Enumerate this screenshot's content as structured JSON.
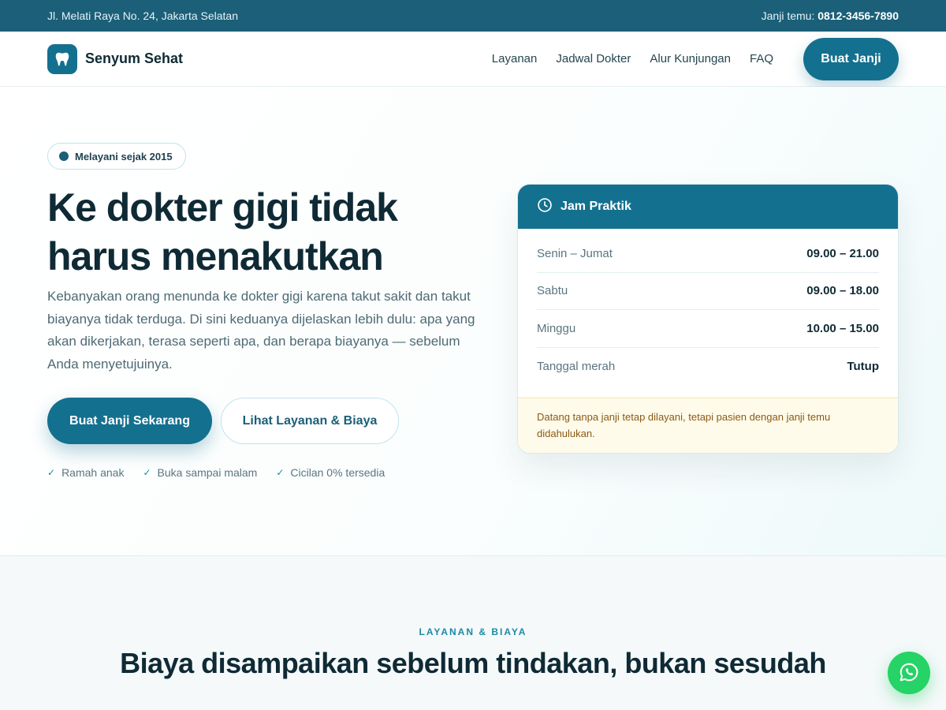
{
  "topbar": {
    "address": "Jl. Melati Raya No. 24, Jakarta Selatan",
    "phone_label": "Janji temu:",
    "phone_number": "0812-3456-7890"
  },
  "nav": {
    "brand": "Senyum Sehat",
    "links": [
      "Layanan",
      "Jadwal Dokter",
      "Alur Kunjungan",
      "FAQ"
    ],
    "cta": "Buat Janji"
  },
  "hero": {
    "badge": "Melayani sejak 2015",
    "title": "Ke dokter gigi tidak harus menakutkan",
    "description": "Kebanyakan orang menunda ke dokter gigi karena takut sakit dan takut biayanya tidak terduga. Di sini keduanya dijelaskan lebih dulu: apa yang akan dikerjakan, terasa seperti apa, dan berapa biayanya — sebelum Anda menyetujuinya.",
    "primary_cta": "Buat Janji Sekarang",
    "secondary_cta": "Lihat Layanan & Biaya",
    "features": [
      "Ramah anak",
      "Buka sampai malam",
      "Cicilan 0% tersedia"
    ]
  },
  "hours": {
    "title": "Jam Praktik",
    "rows": [
      {
        "day": "Senin – Jumat",
        "time": "09.00 – 21.00"
      },
      {
        "day": "Sabtu",
        "time": "09.00 – 18.00"
      },
      {
        "day": "Minggu",
        "time": "10.00 – 15.00"
      },
      {
        "day": "Tanggal merah",
        "time": "Tutup"
      }
    ],
    "note": "Datang tanpa janji tetap dilayani, tetapi pasien dengan janji temu didahulukan."
  },
  "services": {
    "eyebrow": "LAYANAN & BIAYA",
    "title": "Biaya disampaikan sebelum tindakan, bukan sesudah"
  },
  "colors": {
    "primary": "#14708f",
    "topbar": "#1b5f78",
    "accent": "#1c8aa6",
    "whatsapp": "#25d366"
  },
  "icons": {
    "brand": "tooth-icon",
    "hours": "clock-icon",
    "feature": "check-icon",
    "floating": "whatsapp-icon"
  }
}
